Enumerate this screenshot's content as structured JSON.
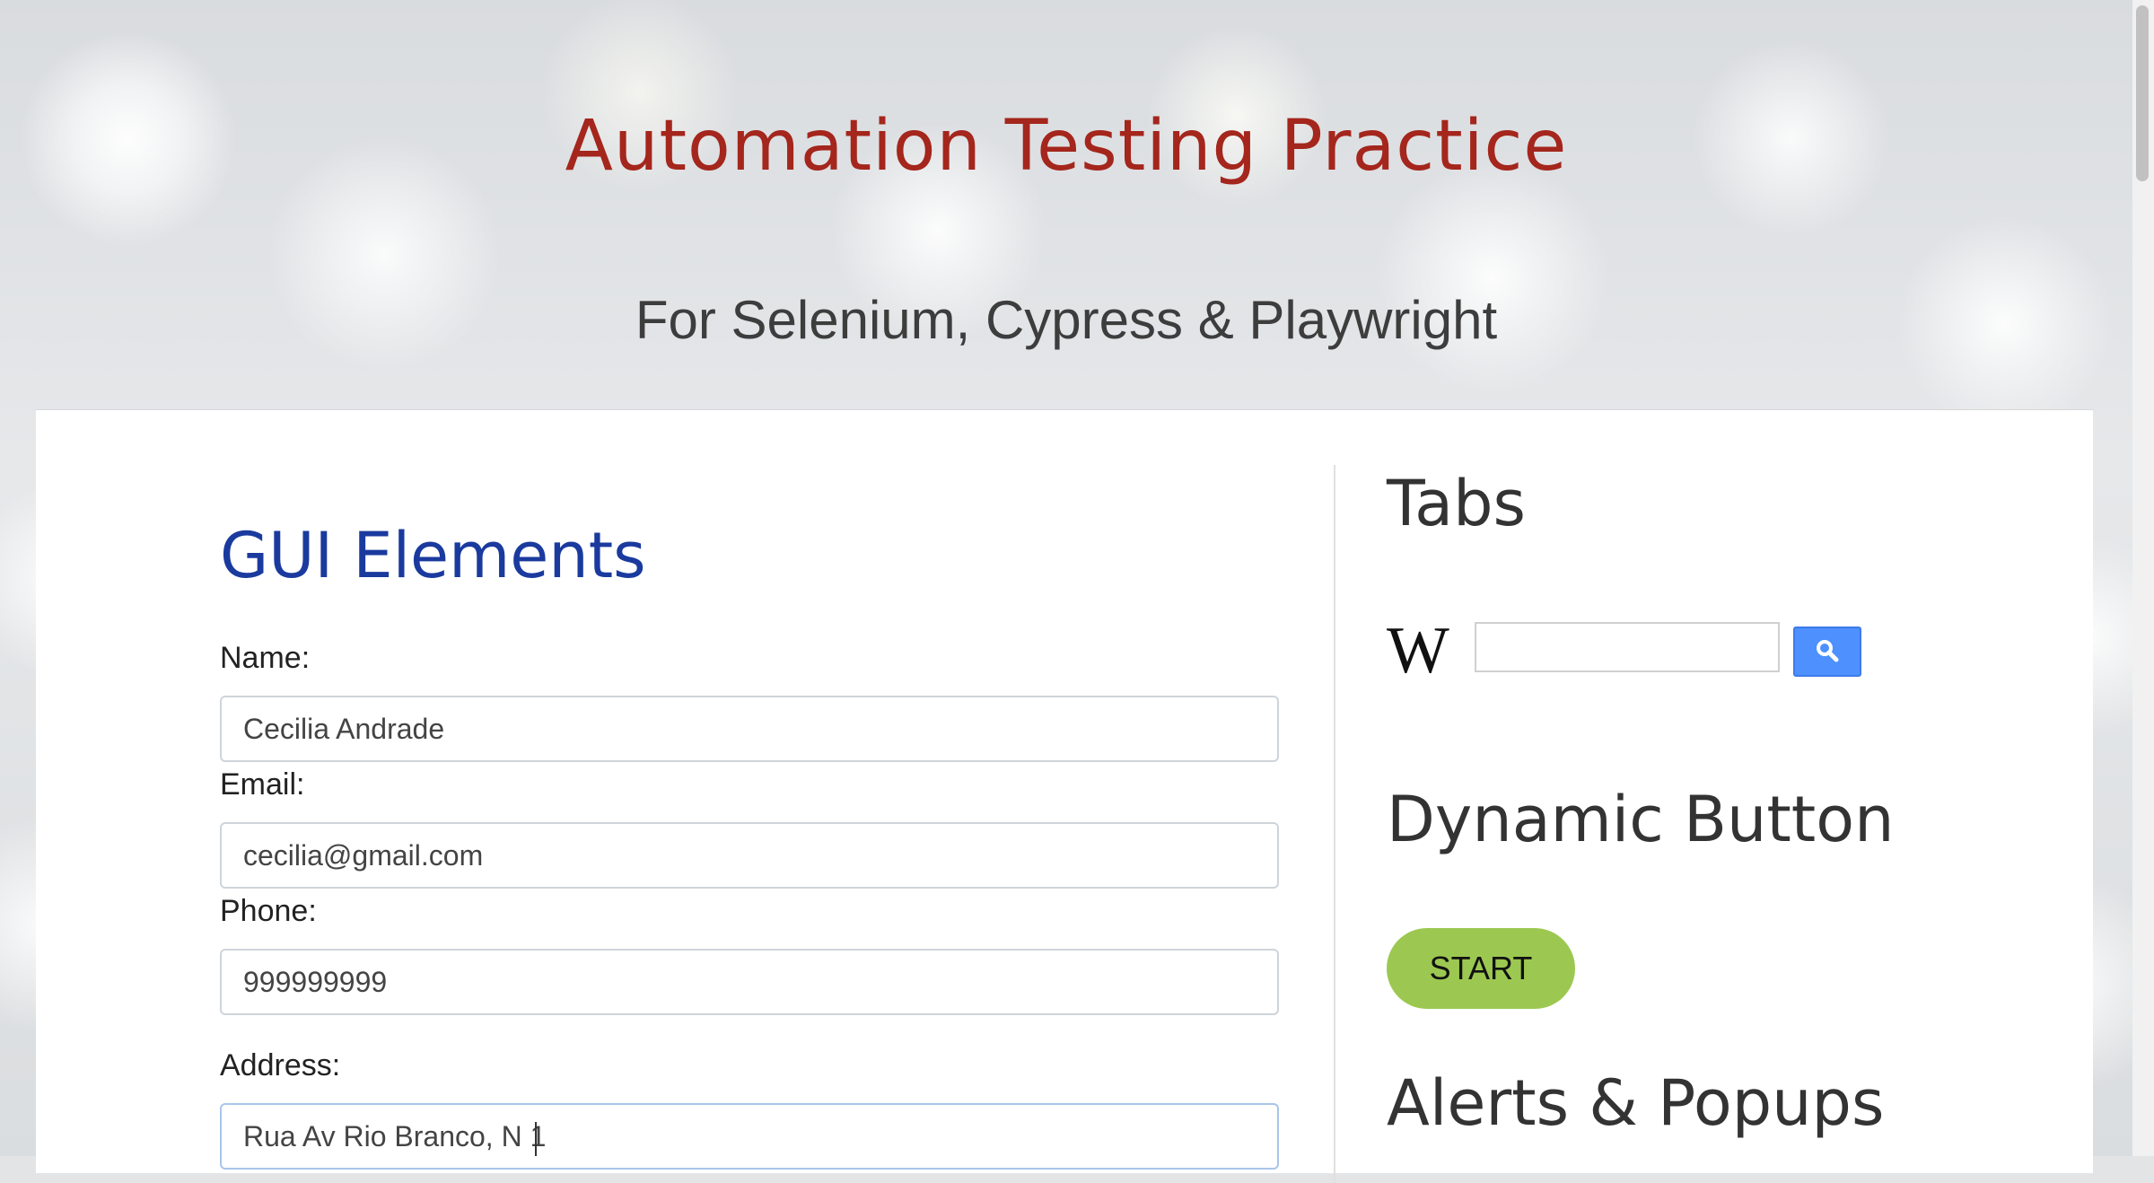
{
  "header": {
    "title": "Automation Testing Practice",
    "subtitle": "For Selenium, Cypress & Playwright"
  },
  "gui": {
    "title": "GUI Elements",
    "name": {
      "label": "Name:",
      "value": "Cecilia Andrade"
    },
    "email": {
      "label": "Email:",
      "value": "cecilia@gmail.com"
    },
    "phone": {
      "label": "Phone:",
      "value": "999999999"
    },
    "address": {
      "label": "Address:",
      "value": "Rua Av Rio Branco, N 1"
    }
  },
  "sidebar": {
    "tabs_title": "Tabs",
    "wiki_logo": "W",
    "wiki_search_value": "",
    "search_icon": "search-icon",
    "dynamic_title": "Dynamic Button",
    "start_label": "START",
    "alerts_title": "Alerts & Popups"
  },
  "colors": {
    "title": "#a4261c",
    "gui_title": "#1a3a9e",
    "start_button": "#9cc851",
    "search_button": "#4d90fe"
  }
}
